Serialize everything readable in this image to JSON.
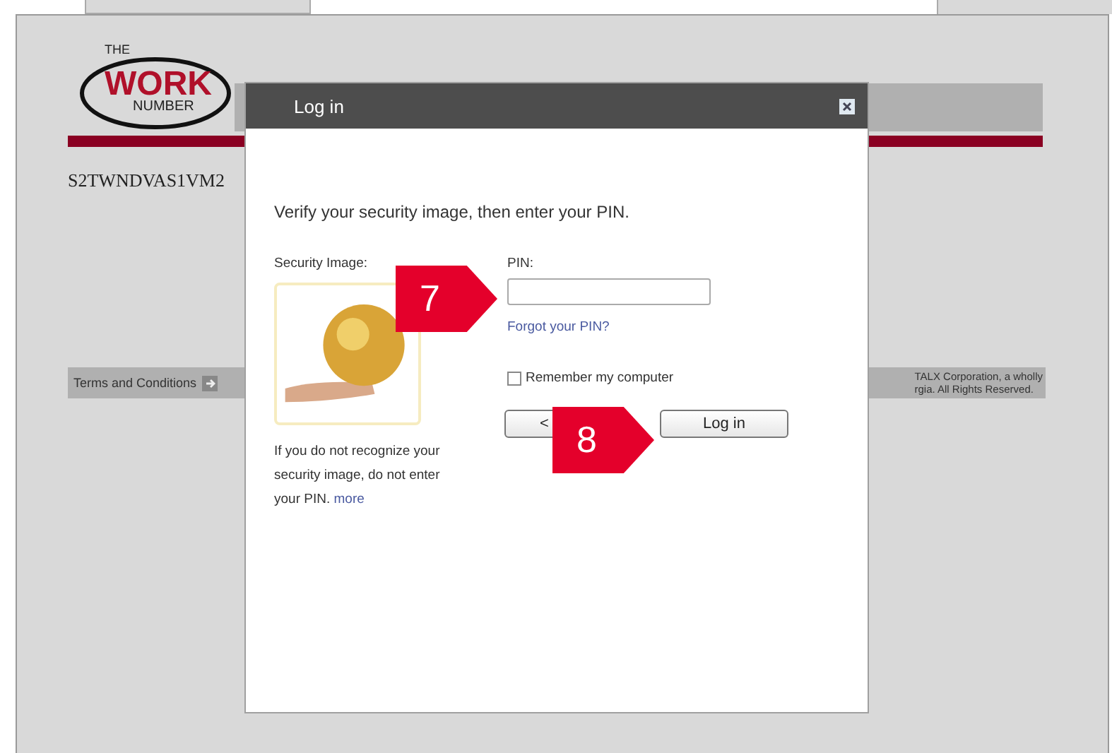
{
  "page": {
    "logo": {
      "top": "THE",
      "main": "WORK",
      "bottom": "NUMBER"
    },
    "server_id": "S2TWNDVAS1VM2",
    "footer": {
      "link": "Terms and Conditions",
      "copyright_lines": [
        "TALX Corporation, a wholly",
        "rgia. All Rights Reserved."
      ]
    }
  },
  "dialog": {
    "title": "Log in",
    "instruction": "Verify your security image, then enter your PIN.",
    "security_image_label": "Security Image:",
    "security_note": "If you do not recognize your security image, do not enter your PIN.",
    "more_link": "more",
    "pin_label": "PIN:",
    "forgot_link": "Forgot your PIN?",
    "remember": {
      "label": "Remember my computer",
      "checked": false
    },
    "buttons": [
      {
        "label": "<",
        "kind": "back"
      },
      {
        "label": "Log in",
        "kind": "primary"
      }
    ]
  },
  "callouts": [
    {
      "number": "7"
    },
    {
      "number": "8"
    }
  ]
}
